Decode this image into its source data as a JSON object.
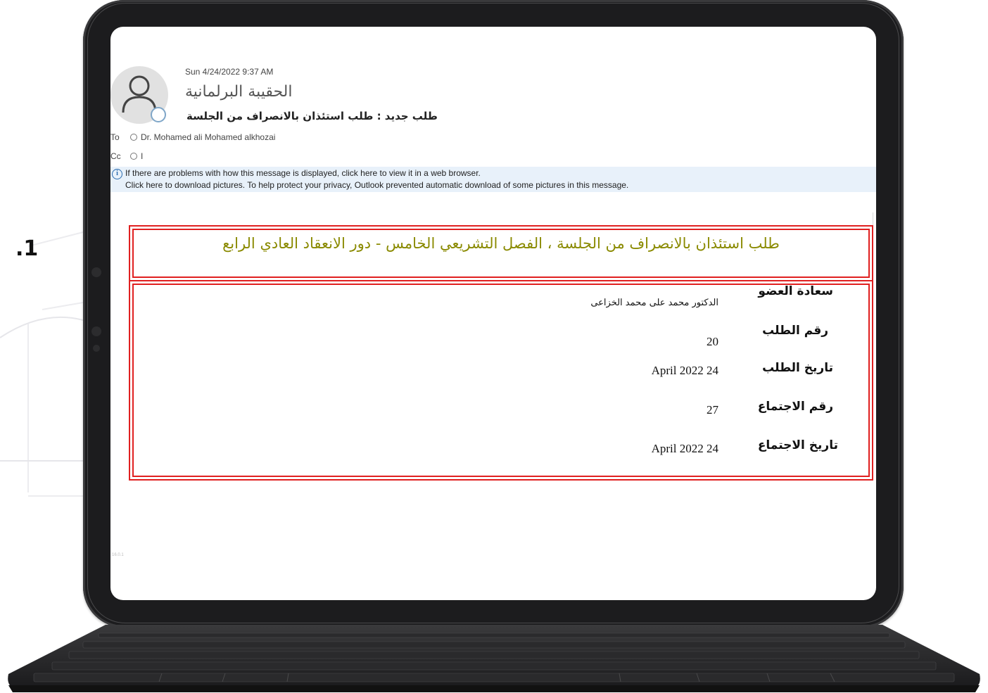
{
  "step_number": ".1",
  "email": {
    "sent_datetime": "Sun 4/24/2022 9:37 AM",
    "sender_name": "الحقيبة البرلمانية",
    "subject": "طلب جديد : طلب استئذان بالانصراف من الجلسة",
    "to_label": "To",
    "to_value": "Dr. Mohamed ali Mohamed alkhozai",
    "cc_label": "Cc",
    "cc_value": "I",
    "info_bar": {
      "line1": "If there are problems with how this message is displayed, click here to view it in a web browser.",
      "line2": "Click here to download pictures. To help protect your privacy, Outlook prevented automatic download of some pictures in this message."
    }
  },
  "request": {
    "title": "طلب استئذان بالانصراف من الجلسة ، الفصل التشريعي الخامس - دور الانعقاد العادي الرابع",
    "fields": [
      {
        "label": "سعادة العضو",
        "value": "الدكتور محمد على محمد الخزاعى"
      },
      {
        "label": "رقم الطلب",
        "value": "20"
      },
      {
        "label": "تاريخ الطلب",
        "value": "April 2022 24"
      },
      {
        "label": "رقم الاجتماع",
        "value": "27"
      },
      {
        "label": "تاريخ الاجتماع",
        "value": "April 2022 24"
      }
    ]
  },
  "version_mark": "16.0.1"
}
